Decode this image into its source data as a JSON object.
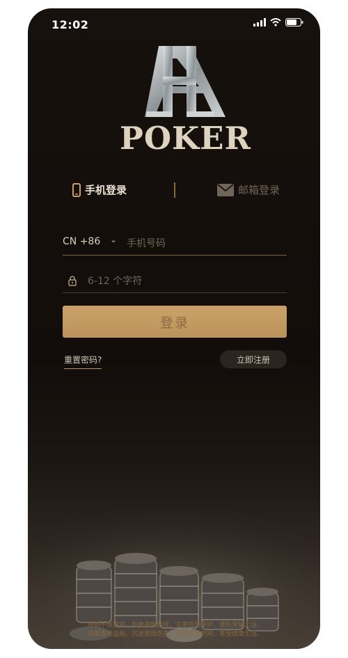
{
  "status_bar": {
    "time": "12:02"
  },
  "brand": {
    "logo_text": "POKER"
  },
  "tabs": {
    "phone_label": "手机登录",
    "email_label": "邮箱登录"
  },
  "form": {
    "country_code": "CN +86",
    "phone_placeholder": "手机号码",
    "password_placeholder": "6-12 个字符"
  },
  "actions": {
    "login_label": "登录",
    "reset_label": "重置密码?",
    "register_label": "立即注册"
  },
  "footer": {
    "notice_line1": "抵制不良游戏，拒绝盗版游戏，注意自我保护，谨防受骗上当，",
    "notice_line2": "适度游戏益脑，沉迷游戏伤身，合理安排时间，享受健康生活。"
  },
  "colors": {
    "accent": "#c7a067",
    "background": "#14100c"
  }
}
